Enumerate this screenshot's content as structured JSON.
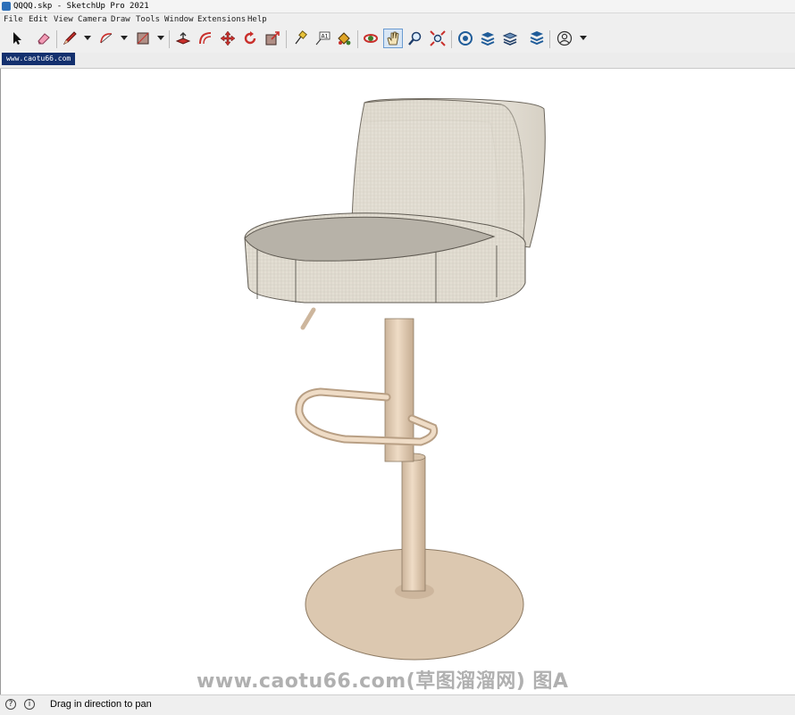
{
  "window": {
    "title": "QQQQ.skp - SketchUp Pro 2021"
  },
  "menu": [
    "File",
    "Edit",
    "View",
    "Camera",
    "Draw",
    "Tools",
    "Window",
    "Extensions",
    "Help"
  ],
  "toolbar": {
    "tools": [
      {
        "name": "select",
        "icon": "select-arrow-icon"
      },
      {
        "name": "eraser",
        "icon": "eraser-icon"
      },
      {
        "name": "line",
        "icon": "pencil-icon",
        "dropdown": true
      },
      {
        "name": "arc",
        "icon": "arc-icon",
        "dropdown": true
      },
      {
        "name": "rectangle",
        "icon": "rectangle-icon",
        "dropdown": true
      },
      {
        "name": "push-pull",
        "icon": "push-pull-icon"
      },
      {
        "name": "offset",
        "icon": "offset-icon"
      },
      {
        "name": "move",
        "icon": "move-icon"
      },
      {
        "name": "rotate",
        "icon": "rotate-icon"
      },
      {
        "name": "scale",
        "icon": "scale-icon"
      },
      {
        "name": "tape-measure",
        "icon": "tape-measure-icon"
      },
      {
        "name": "text",
        "icon": "text-icon",
        "label": "A1"
      },
      {
        "name": "paint-bucket",
        "icon": "paint-bucket-icon"
      },
      {
        "name": "orbit",
        "icon": "orbit-icon"
      },
      {
        "name": "pan",
        "icon": "pan-hand-icon",
        "active": true
      },
      {
        "name": "zoom",
        "icon": "zoom-icon"
      },
      {
        "name": "zoom-extents",
        "icon": "zoom-extents-icon"
      },
      {
        "name": "3d-warehouse",
        "icon": "warehouse-icon"
      },
      {
        "name": "extension-warehouse",
        "icon": "extension-warehouse-icon"
      },
      {
        "name": "layout",
        "icon": "layers-icon"
      },
      {
        "name": "extension-manager",
        "icon": "extension-manager-icon"
      },
      {
        "name": "account",
        "icon": "account-icon",
        "dropdown": true
      }
    ]
  },
  "tabs": [
    {
      "label": "www.caotu66.com",
      "active": true
    }
  ],
  "viewport": {
    "watermark": "www.caotu66.com(草图溜溜网) 图A"
  },
  "status": {
    "message": "Drag in direction to pan",
    "icons": [
      "geo-location-icon",
      "info-icon"
    ]
  },
  "colors": {
    "fabric": "#e3ded3",
    "fabric_shade": "#cfc9bc",
    "seat_top": "#b7b2a8",
    "metal": "#e6d3bd",
    "metal_shade": "#c9b29a",
    "base": "#dcc8b0",
    "tab_bg": "#13306e"
  }
}
